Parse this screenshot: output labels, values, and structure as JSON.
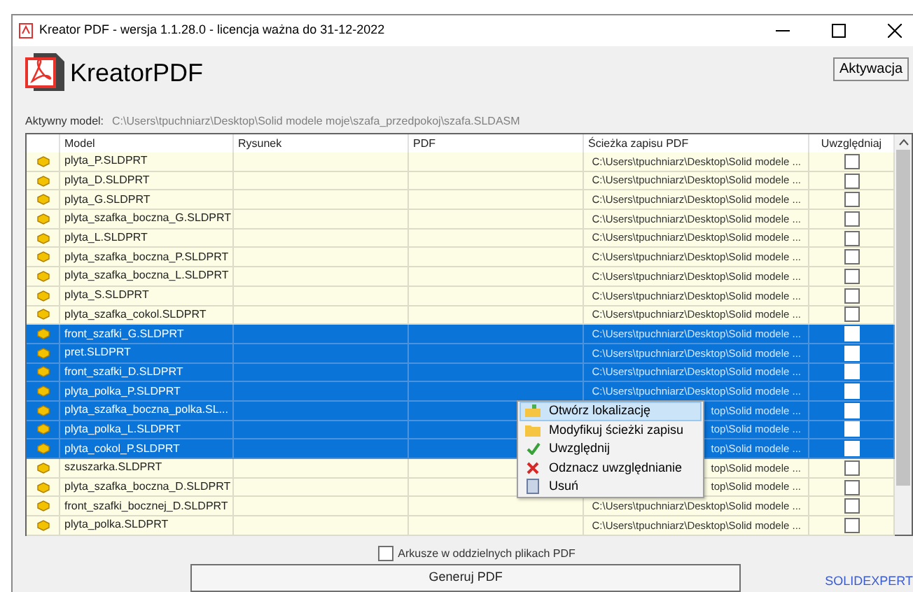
{
  "window": {
    "title": "Kreator PDF - wersja 1.1.28.0 - licencja ważna do 31-12-2022"
  },
  "header": {
    "logo_text": "KreatorPDF",
    "activation_button": "Aktywacja"
  },
  "active_model": {
    "label": "Aktywny model:",
    "path": "C:\\Users\\tpuchniarz\\Desktop\\Solid modele moje\\szafa_przedpokoj\\szafa.SLDASM"
  },
  "table": {
    "columns": [
      "Model",
      "Rysunek",
      "PDF",
      "Ścieżka zapisu PDF",
      "Uwzględniaj"
    ],
    "rows": [
      {
        "model": "plyta_P.SLDPRT",
        "path": "C:\\Users\\tpuchniarz\\Desktop\\Solid modele ...",
        "checked": false,
        "selected": false
      },
      {
        "model": "plyta_D.SLDPRT",
        "path": "C:\\Users\\tpuchniarz\\Desktop\\Solid modele ...",
        "checked": false,
        "selected": false
      },
      {
        "model": "plyta_G.SLDPRT",
        "path": "C:\\Users\\tpuchniarz\\Desktop\\Solid modele ...",
        "checked": false,
        "selected": false
      },
      {
        "model": "plyta_szafka_boczna_G.SLDPRT",
        "path": "C:\\Users\\tpuchniarz\\Desktop\\Solid modele ...",
        "checked": false,
        "selected": false
      },
      {
        "model": "plyta_L.SLDPRT",
        "path": "C:\\Users\\tpuchniarz\\Desktop\\Solid modele ...",
        "checked": false,
        "selected": false
      },
      {
        "model": "plyta_szafka_boczna_P.SLDPRT",
        "path": "C:\\Users\\tpuchniarz\\Desktop\\Solid modele ...",
        "checked": false,
        "selected": false
      },
      {
        "model": "plyta_szafka_boczna_L.SLDPRT",
        "path": "C:\\Users\\tpuchniarz\\Desktop\\Solid modele ...",
        "checked": false,
        "selected": false
      },
      {
        "model": "plyta_S.SLDPRT",
        "path": "C:\\Users\\tpuchniarz\\Desktop\\Solid modele ...",
        "checked": false,
        "selected": false
      },
      {
        "model": "plyta_szafka_cokol.SLDPRT",
        "path": "C:\\Users\\tpuchniarz\\Desktop\\Solid modele ...",
        "checked": false,
        "selected": false
      },
      {
        "model": "front_szafki_G.SLDPRT",
        "path": "C:\\Users\\tpuchniarz\\Desktop\\Solid modele ...",
        "checked": false,
        "selected": true
      },
      {
        "model": "pret.SLDPRT",
        "path": "C:\\Users\\tpuchniarz\\Desktop\\Solid modele ...",
        "checked": false,
        "selected": true
      },
      {
        "model": "front_szafki_D.SLDPRT",
        "path": "C:\\Users\\tpuchniarz\\Desktop\\Solid modele ...",
        "checked": false,
        "selected": true
      },
      {
        "model": "plyta_polka_P.SLDPRT",
        "path": "C:\\Users\\tpuchniarz\\Desktop\\Solid modele ...",
        "checked": false,
        "selected": true
      },
      {
        "model": "plyta_szafka_boczna_polka.SL...",
        "path": "top\\Solid modele ...",
        "checked": false,
        "selected": true
      },
      {
        "model": "plyta_polka_L.SLDPRT",
        "path": "top\\Solid modele ...",
        "checked": false,
        "selected": true
      },
      {
        "model": "plyta_cokol_P.SLDPRT",
        "path": "top\\Solid modele ...",
        "checked": false,
        "selected": true
      },
      {
        "model": "szuszarka.SLDPRT",
        "path": "top\\Solid modele ...",
        "checked": false,
        "selected": false
      },
      {
        "model": "plyta_szafka_boczna_D.SLDPRT",
        "path": "top\\Solid modele ...",
        "checked": false,
        "selected": false
      },
      {
        "model": "front_szafki_bocznej_D.SLDPRT",
        "path": "C:\\Users\\tpuchniarz\\Desktop\\Solid modele ...",
        "checked": false,
        "selected": false
      },
      {
        "model": "plyta_polka.SLDPRT",
        "path": "C:\\Users\\tpuchniarz\\Desktop\\Solid modele ...",
        "checked": false,
        "selected": false
      }
    ]
  },
  "context_menu": [
    {
      "label": "Otwórz lokalizację",
      "kind": "open",
      "selected": true
    },
    {
      "label": "Modyfikuj ścieżki zapisu",
      "kind": "folder",
      "selected": false
    },
    {
      "label": "Uwzględnij",
      "kind": "check",
      "selected": false
    },
    {
      "label": "Odznacz uwzględnianie",
      "kind": "cross",
      "selected": false
    },
    {
      "label": "Usuń",
      "kind": "remove",
      "selected": false
    }
  ],
  "separate_sheets": {
    "label": "Arkusze w oddzielnych plikach PDF",
    "checked": false
  },
  "generate_button": "Generuj PDF",
  "footer_link": "SOLIDEXPERT"
}
